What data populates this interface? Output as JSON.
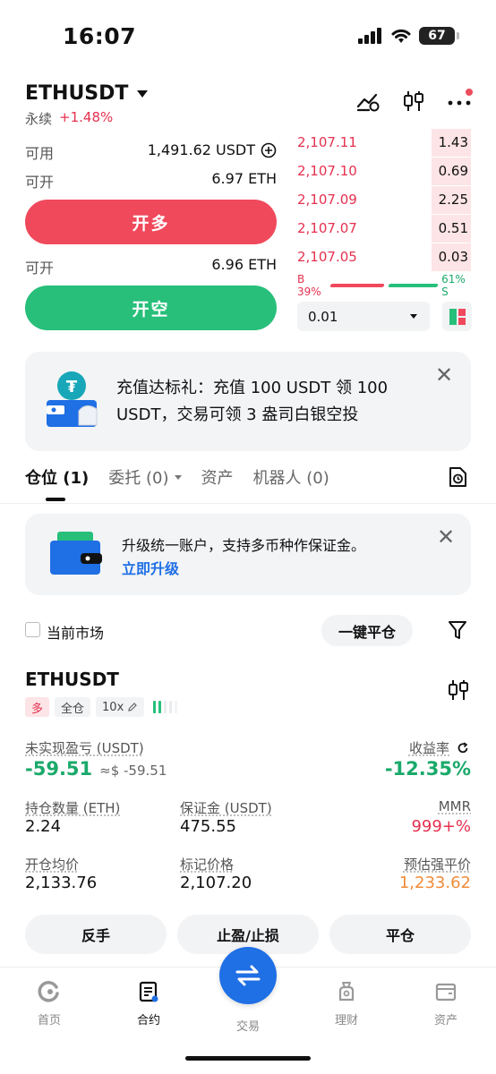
{
  "status_bar": {
    "time": "16:07",
    "battery": "67"
  },
  "header": {
    "symbol": "ETHUSDT",
    "contract_type": "永续",
    "change": "+1.48%"
  },
  "trade_panel": {
    "available_label": "可用",
    "available_value": "1,491.62 USDT",
    "openable_label_1": "可开",
    "openable_value_1": "6.97 ETH",
    "long_button": "开多",
    "openable_label_2": "可开",
    "openable_value_2": "6.96 ETH",
    "short_button": "开空"
  },
  "orderbook": {
    "asks": [
      {
        "price": "2,107.11",
        "qty": "1.43"
      },
      {
        "price": "2,107.10",
        "qty": "0.69"
      },
      {
        "price": "2,107.09",
        "qty": "2.25"
      },
      {
        "price": "2,107.07",
        "qty": "0.51"
      },
      {
        "price": "2,107.05",
        "qty": "0.03"
      }
    ],
    "buy_ratio": "B 39%",
    "sell_ratio": "61% S",
    "precision": "0.01"
  },
  "promo_banner": {
    "text": "充值达标礼：充值 100 USDT 领 100 USDT，交易可领 3 盎司白银空投"
  },
  "tabs": [
    {
      "label": "仓位",
      "count": "(1)"
    },
    {
      "label": "委托",
      "count": "(0)"
    },
    {
      "label": "资产",
      "count": ""
    },
    {
      "label": "机器人",
      "count": "(0)"
    }
  ],
  "upgrade_banner": {
    "text": "升级统一账户，支持多币种作保证金。",
    "link": "立即升级"
  },
  "filter": {
    "current_market": "当前市场",
    "close_all": "一键平仓"
  },
  "position": {
    "symbol": "ETHUSDT",
    "side_tag": "多",
    "margin_tag": "全仓",
    "leverage": "10x",
    "upnl_label": "未实现盈亏 (USDT)",
    "upnl_value": "-59.51",
    "upnl_approx": "≈$ -59.51",
    "roe_label": "收益率",
    "roe_value": "-12.35%",
    "size_label": "持仓数量 (ETH)",
    "size_value": "2.24",
    "margin_label": "保证金 (USDT)",
    "margin_value": "475.55",
    "mmr_label": "MMR",
    "mmr_value": "999+%",
    "entry_label": "开仓均价",
    "entry_value": "2,133.76",
    "mark_label": "标记价格",
    "mark_value": "2,107.20",
    "liq_label": "预估强平价",
    "liq_value": "1,233.62",
    "btn_reverse": "反手",
    "btn_tpsl": "止盈/止损",
    "btn_close": "平仓"
  },
  "bottom_nav": {
    "home": "首页",
    "contract": "合约",
    "trade": "交易",
    "finance": "理财",
    "assets": "资产"
  },
  "colors": {
    "red": "#f0495c",
    "green": "#27bf7a",
    "blue": "#1f6fe5",
    "orange": "#f08c3a"
  }
}
